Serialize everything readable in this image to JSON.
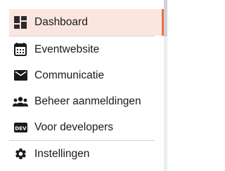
{
  "nav": {
    "items": [
      {
        "label": "Dashboard",
        "icon": "dashboard-icon",
        "active": true
      },
      {
        "label": "Eventwebsite",
        "icon": "calendar-icon",
        "active": false
      },
      {
        "label": "Communicatie",
        "icon": "mail-icon",
        "active": false
      },
      {
        "label": "Beheer aanmeldingen",
        "icon": "people-icon",
        "active": false
      },
      {
        "label": "Voor developers",
        "icon": "dev-icon",
        "active": false
      },
      {
        "label": "Instellingen",
        "icon": "gear-icon",
        "active": false
      }
    ]
  },
  "colors": {
    "active_background": "#fbe6df",
    "active_accent": "#ee6e4a",
    "text": "#1a1a1a",
    "icon": "#1a1a1a",
    "divider": "#d4d4d4"
  }
}
